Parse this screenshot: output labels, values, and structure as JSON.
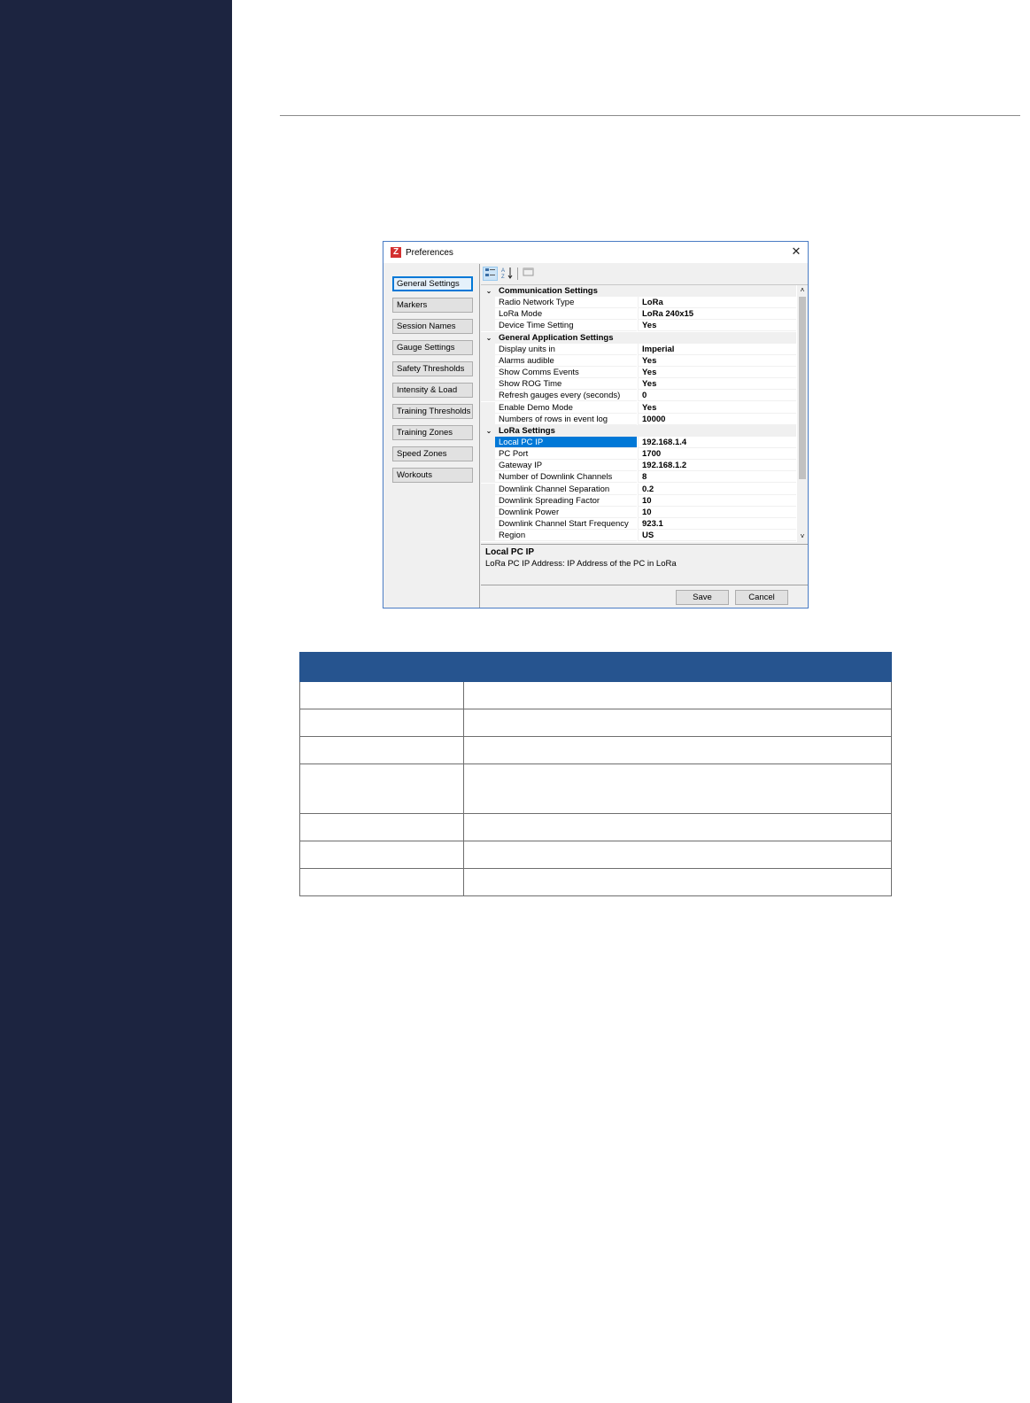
{
  "dialog": {
    "logo_letter": "Z",
    "title": "Preferences",
    "close_glyph": "✕",
    "nav_items": [
      "General Settings",
      "Markers",
      "Session Names",
      "Gauge Settings",
      "Safety Thresholds",
      "Intensity & Load",
      "Training Thresholds",
      "Training Zones",
      "Speed Zones",
      "Workouts"
    ],
    "active_nav": "General Settings",
    "toolbar": {
      "categorized_icon": "categorized-view-icon",
      "alphabetical_icon": "sort-alphabetical-icon",
      "property_pages_icon": "property-pages-icon"
    },
    "grid": {
      "categories": [
        {
          "label": "Communication Settings",
          "properties": [
            {
              "name": "Radio Network Type",
              "value": "LoRa"
            },
            {
              "name": "LoRa Mode",
              "value": "LoRa 240x15"
            },
            {
              "name": "Device Time Setting",
              "value": "Yes"
            }
          ]
        },
        {
          "label": "General Application Settings",
          "properties": [
            {
              "name": "Display units in",
              "value": "Imperial"
            },
            {
              "name": "Alarms audible",
              "value": "Yes"
            },
            {
              "name": "Show Comms Events",
              "value": "Yes"
            },
            {
              "name": "Show ROG Time",
              "value": "Yes"
            },
            {
              "name": "Refresh gauges every (seconds)",
              "value": "0"
            },
            {
              "name": "Enable Demo Mode",
              "value": "Yes"
            },
            {
              "name": "Numbers of rows in event log",
              "value": "10000"
            }
          ]
        },
        {
          "label": "LoRa Settings",
          "properties": [
            {
              "name": "Local PC IP",
              "value": "192.168.1.4"
            },
            {
              "name": "PC Port",
              "value": "1700"
            },
            {
              "name": " Gateway  IP",
              "value": "192.168.1.2"
            },
            {
              "name": "Number of Downlink Channels",
              "value": "8"
            },
            {
              "name": "Downlink Channel Separation",
              "value": "0.2"
            },
            {
              "name": "Downlink Spreading Factor",
              "value": "10"
            },
            {
              "name": "Downlink Power",
              "value": "10"
            },
            {
              "name": "Downlink Channel Start Frequency",
              "value": "923.1"
            },
            {
              "name": "Region",
              "value": "US"
            }
          ]
        }
      ],
      "selected_property": "Local PC IP",
      "collapse_glyph": "⌄",
      "scroll_up_glyph": "˄",
      "scroll_down_glyph": "˅"
    },
    "description": {
      "title": "Local PC IP",
      "body": "LoRa PC  IP Address: IP Address of the PC in  LoRa"
    },
    "buttons": {
      "save": "Save",
      "cancel": "Cancel"
    }
  },
  "colors": {
    "left_band": "#1c2440",
    "table_header": "#26548f",
    "selection": "#0078d7"
  }
}
